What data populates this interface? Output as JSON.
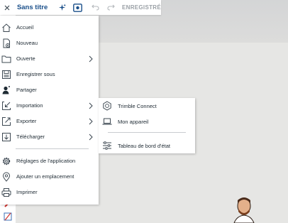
{
  "header": {
    "title": "Sans titre",
    "status": "ENREGISTRÉ"
  },
  "menu": {
    "items": [
      {
        "label": "Accueil"
      },
      {
        "label": "Nouveau"
      },
      {
        "label": "Ouverte"
      },
      {
        "label": "Enregistrer sous"
      },
      {
        "label": "Partager"
      },
      {
        "label": "Importation"
      },
      {
        "label": "Exporter"
      },
      {
        "label": "Télécharger"
      },
      {
        "label": "Réglages de l'application"
      },
      {
        "label": "Ajouter un emplacement"
      },
      {
        "label": "Imprimer"
      }
    ]
  },
  "submenu": {
    "items": [
      {
        "label": "Trimble Connect"
      },
      {
        "label": "Mon appareil"
      },
      {
        "label": "Tableau de bord d'état"
      }
    ]
  },
  "colors": {
    "accent": "#1a4f8a",
    "icon": "#3d4852",
    "disabled": "#9aa0a6"
  }
}
